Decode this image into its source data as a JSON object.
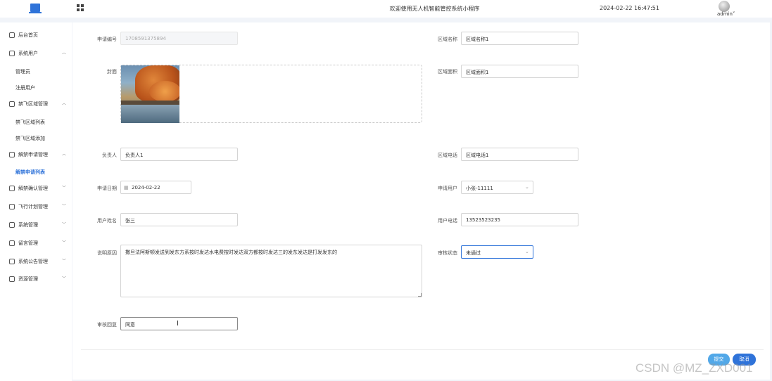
{
  "header": {
    "title": "欢迎使用无人机智能管控系统小程序",
    "datetime": "2024-02-22 16:47:51",
    "user": "admin",
    "icons": [
      "monitor-logo-icon",
      "apps-grid-icon",
      "avatar"
    ]
  },
  "sidebar": {
    "items": [
      {
        "label": "后台首页",
        "icon": "home-icon"
      },
      {
        "label": "系统用户",
        "icon": "user-icon",
        "expanded": true,
        "children": [
          "管理员",
          "注册用户"
        ]
      },
      {
        "label": "禁飞区域管理",
        "icon": "area-icon",
        "expanded": true,
        "children": [
          "禁飞区域列表",
          "禁飞区域添加"
        ]
      },
      {
        "label": "解禁申请管理",
        "icon": "apply-icon",
        "expanded": true,
        "children": [
          "解禁申请列表"
        ]
      },
      {
        "label": "解禁确认管理",
        "icon": "confirm-icon"
      },
      {
        "label": "飞行计划管理",
        "icon": "plan-icon"
      },
      {
        "label": "系统管理",
        "icon": "system-icon"
      },
      {
        "label": "留言管理",
        "icon": "message-icon"
      },
      {
        "label": "系统公告管理",
        "icon": "notice-icon"
      },
      {
        "label": "资源管理",
        "icon": "resource-icon"
      }
    ],
    "active": "解禁申请列表"
  },
  "form": {
    "apply_no": {
      "label": "申请编号",
      "value": "1708591375894"
    },
    "cover": {
      "label": "封面"
    },
    "area_name": {
      "label": "区域名称",
      "value": "区域名称1"
    },
    "area_size": {
      "label": "区域面积",
      "value": "区域面积1"
    },
    "owner": {
      "label": "负责人",
      "value": "负责人1"
    },
    "area_phone": {
      "label": "区域电话",
      "value": "区域电话1"
    },
    "apply_date": {
      "label": "申请日期",
      "value": "2024-02-22"
    },
    "apply_user": {
      "label": "申请用户",
      "value": "小张-11111"
    },
    "user_name": {
      "label": "用户姓名",
      "value": "张三"
    },
    "user_phone": {
      "label": "用户电话",
      "value": "13523523235"
    },
    "reason": {
      "label": "说明原因",
      "value": "撒旦法阿斯顿发送到发东方系按时发达水电费按时发达双方都按时发达三的发东发达是打发发东的"
    },
    "audit_status": {
      "label": "审核状态",
      "value": "未通过"
    },
    "audit_reply": {
      "label": "审核回复",
      "value": "同意"
    }
  },
  "actions": {
    "submit": "提交",
    "cancel": "取消"
  },
  "watermark": "CSDN @MZ_ZXD001",
  "colors": {
    "accent": "#2f73d9",
    "submit": "#52a8e8",
    "background": "#f1f4f9"
  }
}
